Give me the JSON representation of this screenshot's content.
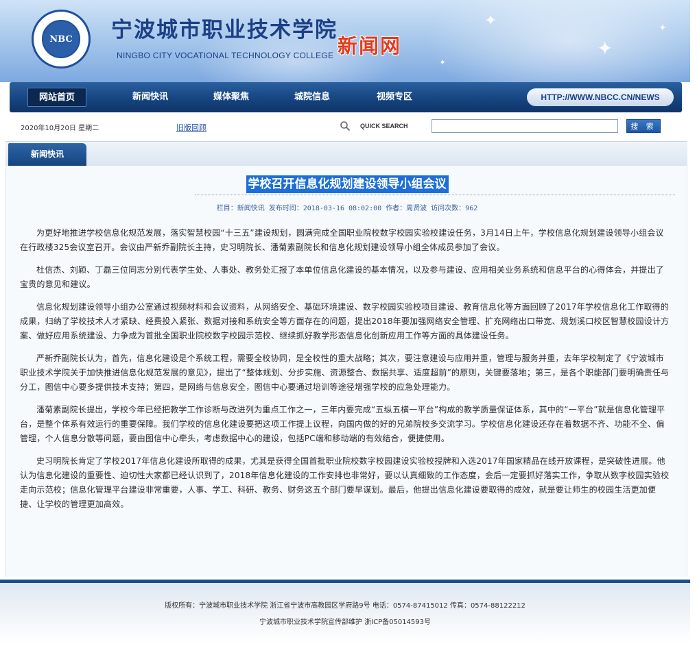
{
  "header": {
    "college_name_cn": "宁波城市职业技术学院",
    "college_name_en": "NINGBO CITY VOCATIONAL TECHNOLOGY COLLEGE",
    "site_name": "新闻网",
    "logo_text": "NBC"
  },
  "nav": {
    "items": [
      {
        "label": "网站首页",
        "active": true
      },
      {
        "label": "新闻快讯",
        "active": false
      },
      {
        "label": "媒体聚焦",
        "active": false
      },
      {
        "label": "城院信息",
        "active": false
      },
      {
        "label": "视频专区",
        "active": false
      }
    ],
    "url": "HTTP://WWW.NBCC.CN/NEWS"
  },
  "info": {
    "date": "2020年10月20日 星期二",
    "archive_link": "旧版回顾",
    "quick_search_label": "QUICK SEARCH",
    "search_value": "",
    "search_button": "搜 索"
  },
  "section": {
    "tab_label": "新闻快讯"
  },
  "article": {
    "title": "学校召开信息化规划建设领导小组会议",
    "meta": "栏目：新闻快讯  发布时间：2018-03-16 08:02:00   作者：周贤波  访问次数：962",
    "paragraphs": [
      "为更好地推进学校信息化规范发展，落实智慧校园“十三五”建设规划，圆满完成全国职业院校数字校园实验校建设任务，3月14日上午，学校信息化规划建设领导小组会议在行政楼325会议室召开。会议由严新乔副院长主持，史习明院长、潘菊素副院长和信息化规划建设领导小组全体成员参加了会议。",
      "杜信杰、刘颖、丁磊三位同志分别代表学生处、人事处、教务处汇报了本单位信息化建设的基本情况，以及参与建设、应用相关业务系统和信息平台的心得体会，并提出了宝贵的意见和建议。",
      "信息化规划建设领导小组办公室通过视频材料和会议资料，从网络安全、基础环境建设、数字校园实验校项目建设、教育信息化等方面回顾了2017年学校信息化工作取得的成果，归纳了学校技术人才紧缺、经费投入紧张、数据对接和系统安全等方面存在的问题，提出2018年要加强网络安全管理、扩充网络出口带宽、规划溪口校区智慧校园设计方案、做好应用系统建设、力争成为首批全国职业院校数字校园示范校、继续抓好教学形态信息化创新应用工作等方面的具体建设任务。",
      "严新乔副院长认为，首先，信息化建设是个系统工程，需要全校协同，是全校性的重大战略；其次，要注意建设与应用并重，管理与服务并重，去年学校制定了《宁波城市职业技术学院关于加快推进信息化规范发展的意见》，提出了“整体规划、分步实施、资源整合、数据共享、适度超前”的原则，关键要落地；第三，是各个职能部门要明确责任与分工，图信中心要多提供技术支持；第四，是网络与信息安全，图信中心要通过培训等途径增强学校的应急处理能力。",
      "潘菊素副院长提出，学校今年已经把教学工作诊断与改进列为重点工作之一，三年内要完成“五纵五横一平台”构成的教学质量保证体系，其中的“一平台”就是信息化管理平台，是整个体系有效运行的重要保障。我们学校的信息化建设要把这项工作提上议程，向国内做的好的兄弟院校多交流学习。学校信息化建设还存在着数据不齐、功能不全、偏管理，个人信息分散等问题，要由图信中心牵头，考虑数据中心的建设，包括PC端和移动端的有效结合，便捷使用。",
      "史习明院长肯定了学校2017年信息化建设所取得的成果，尤其是获得全国首批职业院校数字校园建设实验校授牌和入选2017年国家精品在线开放课程，是突破性进展。他认为信息化建设的重要性、迫切性大家都已经认识到了，2018年信息化建设的工作安排也非常好，要以认真细致的工作态度，会后一定要抓好落实工作，争取从数字校园实验校走向示范校；信息化管理平台建设非常重要，人事、学工、科研、教务、财务这五个部门要早谋划。最后，他提出信息化建设要取得的成效，就是要让师生的校园生活更加便捷、让学校的管理更加高效。"
    ]
  },
  "footer": {
    "line1": "版权所有：宁波城市职业技术学院 浙江省宁波市高教园区学府路9号 电话：0574-87415012 传真：0574-88122212",
    "line2": "宁波城市职业技术学院宣传部维护 浙ICP备05014593号"
  },
  "colors": {
    "nav_blue": "#164580",
    "title_highlight": "#1d6fd6",
    "site_name_red": "#e23b1f"
  }
}
